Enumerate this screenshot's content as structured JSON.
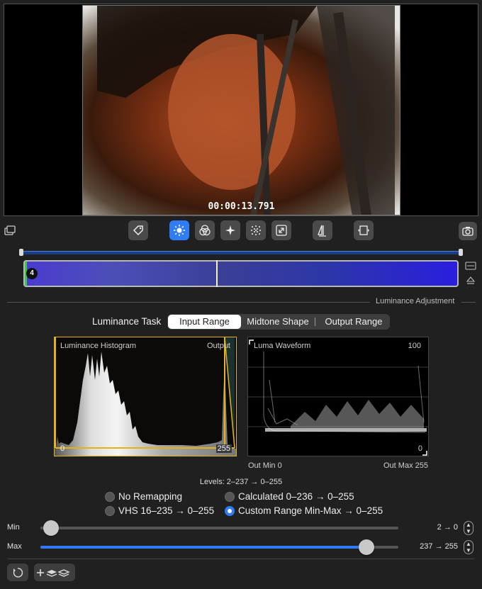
{
  "viewer": {
    "timecode": "00:00:13.791"
  },
  "toolbar": {
    "left_icon": "window-layers-icon",
    "buttons": [
      "tag-icon",
      "brightness-icon",
      "color-circles-icon",
      "sparkle-icon",
      "noise-icon",
      "resize-icon",
      "flip-icon",
      "film-crop-icon"
    ],
    "active": "brightness-icon",
    "right_icon": "camera-icon"
  },
  "timeline": {
    "badge": "4",
    "accent": "#2f7cf6"
  },
  "section": {
    "title": "Luminance Adjustment"
  },
  "task": {
    "label": "Luminance Task",
    "segments": [
      "Input Range",
      "Midtone Shape",
      "Output Range"
    ],
    "selected": "Input Range"
  },
  "histogram": {
    "title": "Luminance Histogram",
    "output_label": "Output",
    "min_label": "0",
    "max_label": "255"
  },
  "waveform": {
    "title": "Luma Waveform",
    "top_label": "100",
    "bottom_label": "0",
    "out_min": "Out Min 0",
    "out_max": "Out Max 255"
  },
  "levels": "Levels: 2–237 → 0–255",
  "remap_options": [
    {
      "label": "No Remapping",
      "selected": false
    },
    {
      "label": "Calculated 0–236 → 0–255",
      "selected": false
    },
    {
      "label": "VHS 16–235 → 0–255",
      "selected": false
    },
    {
      "label": "Custom Range Min-Max → 0–255",
      "selected": true
    }
  ],
  "sliders": {
    "min": {
      "label": "Min",
      "value_text": "2 → 0",
      "value": 2,
      "range": [
        0,
        255
      ]
    },
    "max": {
      "label": "Max",
      "value_text": "237 → 255",
      "value": 237,
      "range": [
        0,
        255
      ]
    }
  },
  "bottom": {
    "reset_icon": "reset-icon",
    "add_layers_icon": "add-layers-icon"
  }
}
